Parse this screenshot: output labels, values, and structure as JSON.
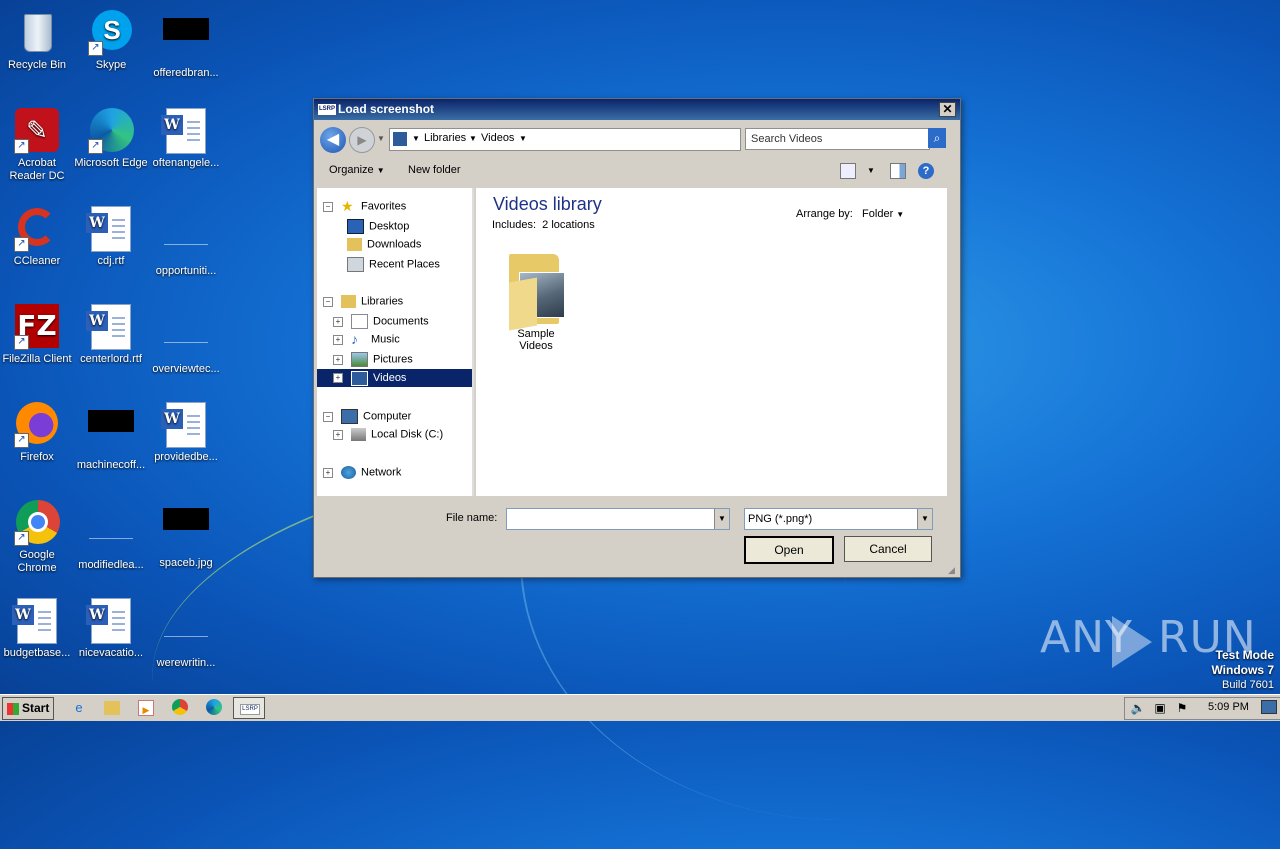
{
  "desktop": {
    "icons": [
      {
        "label": "Recycle Bin"
      },
      {
        "label": "Skype"
      },
      {
        "label": "offeredbran..."
      },
      {
        "label": "Acrobat Reader DC"
      },
      {
        "label": "Microsoft Edge"
      },
      {
        "label": "oftenangele..."
      },
      {
        "label": "CCleaner"
      },
      {
        "label": "cdj.rtf"
      },
      {
        "label": "opportuniti..."
      },
      {
        "label": "FileZilla Client"
      },
      {
        "label": "centerlord.rtf"
      },
      {
        "label": "overviewtec..."
      },
      {
        "label": "Firefox"
      },
      {
        "label": "machinecoff..."
      },
      {
        "label": "providedbe..."
      },
      {
        "label": "Google Chrome"
      },
      {
        "label": "modifiedlea..."
      },
      {
        "label": "spaceb.jpg"
      },
      {
        "label": "budgetbase..."
      },
      {
        "label": "nicevacatio..."
      },
      {
        "label": "werewritin..."
      }
    ],
    "watermark": "ANY",
    "watermark2": "RUN",
    "test_mode": {
      "line1": "Test Mode",
      "line2": "Windows 7",
      "line3": "Build 7601"
    }
  },
  "dialog": {
    "title": "Load screenshot",
    "app_icon_text": "LSRP",
    "close": "✕",
    "breadcrumb": [
      "Libraries",
      "Videos"
    ],
    "search_placeholder": "Search Videos",
    "toolbar": {
      "organize": "Organize",
      "new_folder": "New folder",
      "help": "?"
    },
    "nav": {
      "favorites": "Favorites",
      "desktop": "Desktop",
      "downloads": "Downloads",
      "recent": "Recent Places",
      "libraries": "Libraries",
      "documents": "Documents",
      "music": "Music",
      "pictures": "Pictures",
      "videos": "Videos",
      "computer": "Computer",
      "local_disk": "Local Disk (C:)",
      "network": "Network"
    },
    "content": {
      "title": "Videos library",
      "includes_label": "Includes:",
      "includes_value": "2 locations",
      "arrange_label": "Arrange by:",
      "arrange_value": "Folder",
      "folder": "Sample Videos"
    },
    "file_name_label": "File name:",
    "file_name_value": "",
    "file_type": "PNG (*.png*)",
    "open": "Open",
    "cancel": "Cancel"
  },
  "taskbar": {
    "start": "Start",
    "active_task": "LSRP",
    "clock": "5:09 PM"
  },
  "colors": {
    "selection": "#0a246a",
    "titlebar": "#0a246a",
    "desktop": "#1573d6"
  }
}
